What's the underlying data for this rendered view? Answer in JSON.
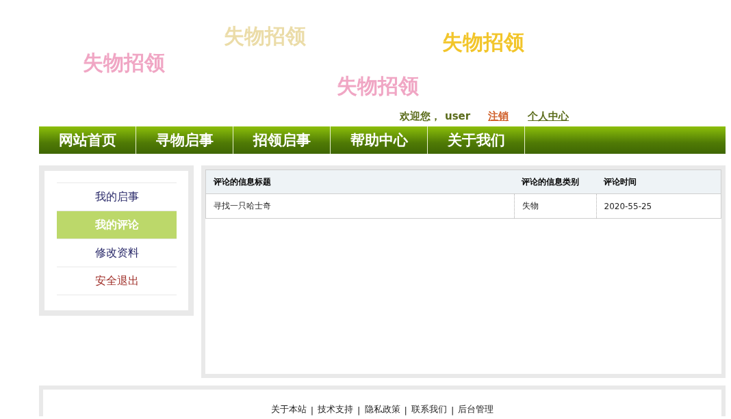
{
  "banner": {
    "logos": [
      {
        "text": "失物招领",
        "color": "#f0a6c4"
      },
      {
        "text": "失物招领",
        "color": "#ebdca8"
      },
      {
        "text": "失物招领",
        "color": "#f2c52a"
      },
      {
        "text": "失物招领",
        "color": "#f0a6c4"
      }
    ]
  },
  "user_bar": {
    "greeting": "欢迎您，",
    "username": "user",
    "links": [
      "注销",
      "个人中心"
    ]
  },
  "nav": {
    "items": [
      "网站首页",
      "寻物启事",
      "招领启事",
      "帮助中心",
      "关于我们"
    ]
  },
  "sidebar": {
    "items": [
      {
        "label": "我的启事",
        "selected": false
      },
      {
        "label": "我的评论",
        "selected": true
      },
      {
        "label": "修改资料",
        "selected": false
      },
      {
        "label": "安全退出",
        "selected": false
      }
    ]
  },
  "table": {
    "columns": [
      "评论的信息标题",
      "评论的信息类别",
      "评论时间"
    ],
    "rows": [
      [
        "寻找一只哈士奇",
        "失物",
        "2020-55-25"
      ]
    ]
  },
  "footer": {
    "separators": [
      "|",
      "|",
      "|",
      "|"
    ],
    "links": [
      "关于本站",
      "技术支持",
      "隐私政策",
      "联系我们",
      "后台管理"
    ]
  }
}
